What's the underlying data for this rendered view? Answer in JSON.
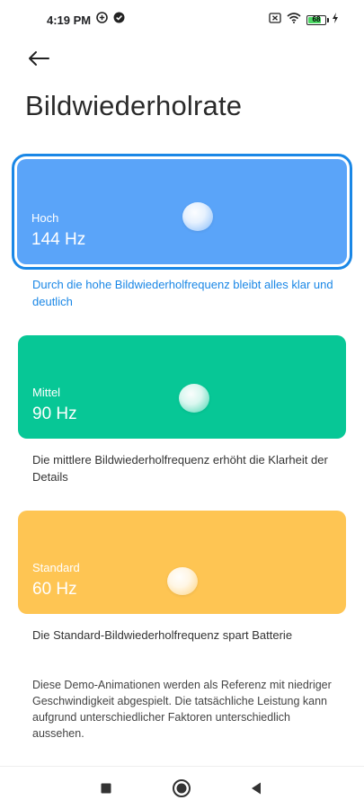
{
  "status_bar": {
    "time": "4:19 PM",
    "battery_level": "68"
  },
  "header": {
    "title": "Bildwiederholrate"
  },
  "options": [
    {
      "label": "Hoch",
      "value": "144 Hz",
      "description": "Durch die hohe Bildwiederholfrequenz bleibt alles klar und deutlich",
      "color": "#5aa4f9",
      "selected": true
    },
    {
      "label": "Mittel",
      "value": "90 Hz",
      "description": "Die mittlere Bildwiederholfrequenz erhöht die Klarheit der Details",
      "color": "#07c796",
      "selected": false
    },
    {
      "label": "Standard",
      "value": "60 Hz",
      "description": "Die Standard-Bildwiederholfrequenz spart Batterie",
      "color": "#fec553",
      "selected": false
    }
  ],
  "note": "Diese Demo-Animationen werden als Referenz mit niedriger Geschwindigkeit abgespielt. Die tatsächliche Leistung kann aufgrund unterschiedlicher Faktoren unterschiedlich aussehen.",
  "colors": {
    "accent": "#1a87e6"
  }
}
